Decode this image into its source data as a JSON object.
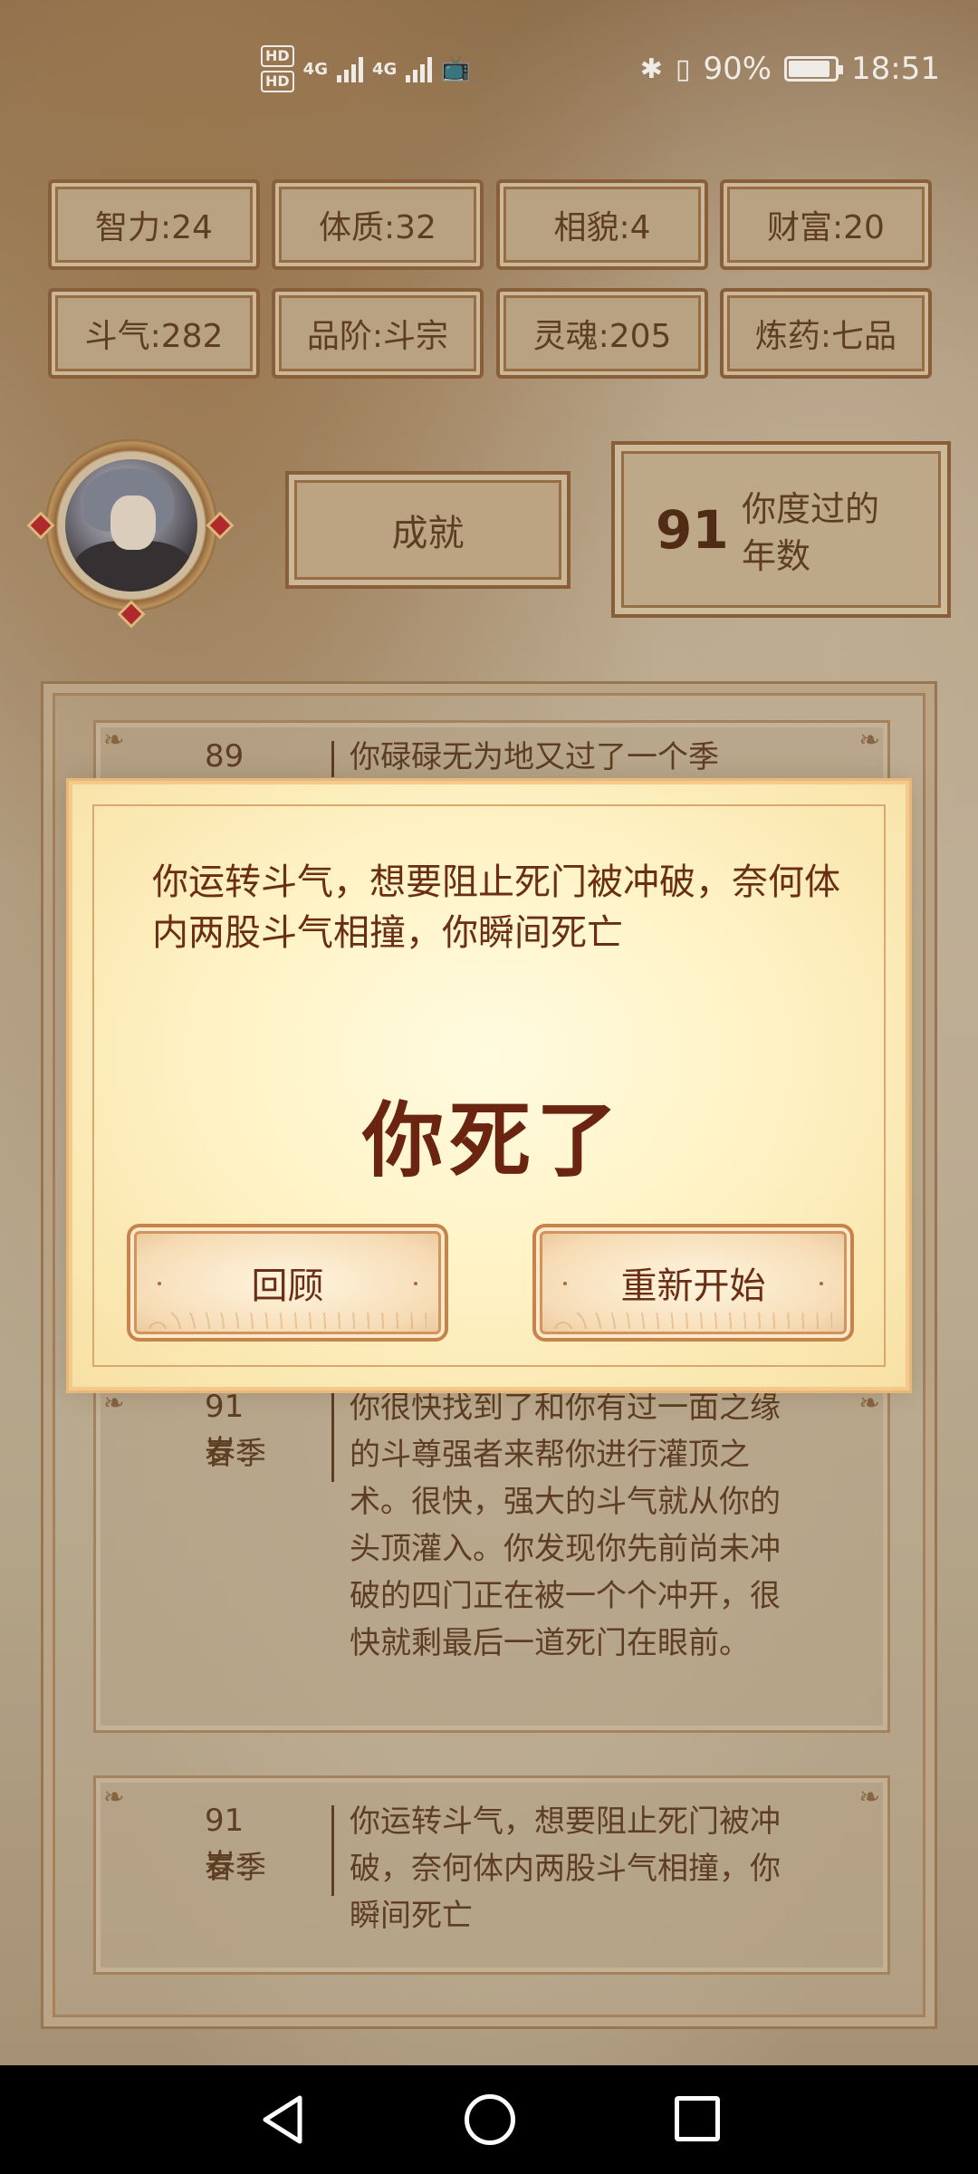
{
  "status_bar": {
    "hd1": "HD",
    "hd2": "HD",
    "net1": "4G",
    "net2": "4G",
    "battery_percent": "90%",
    "battery_level": 0.9,
    "time": "18:51"
  },
  "stats": [
    {
      "label": "智力:24"
    },
    {
      "label": "体质:32"
    },
    {
      "label": "相貌:4"
    },
    {
      "label": "财富:20"
    },
    {
      "label": "斗气:282"
    },
    {
      "label": "品阶:斗宗"
    },
    {
      "label": "灵魂:205"
    },
    {
      "label": "炼药:七品"
    }
  ],
  "achievements_button": "成就",
  "years": {
    "value": "91",
    "label": "你度过的年数"
  },
  "log": [
    {
      "age": "89岁：",
      "season": "",
      "text": "你碌碌无为地又过了一个季"
    },
    {
      "age": "91岁：",
      "season": "春季",
      "text": "你很快找到了和你有过一面之缘的斗尊强者来帮你进行灌顶之术。很快，强大的斗气就从你的头顶灌入。你发现你先前尚未冲破的四门正在被一个个冲开，很快就剩最后一道死门在眼前。"
    },
    {
      "age": "91岁：",
      "season": "春季",
      "text": "你运转斗气，想要阻止死门被冲破，奈何体内两股斗气相撞，你瞬间死亡"
    }
  ],
  "dialog": {
    "message": "你运转斗气，想要阻止死门被冲破，奈何体内两股斗气相撞，你瞬间死亡",
    "title": "你死了",
    "review_button": "回顾",
    "restart_button": "重新开始"
  }
}
